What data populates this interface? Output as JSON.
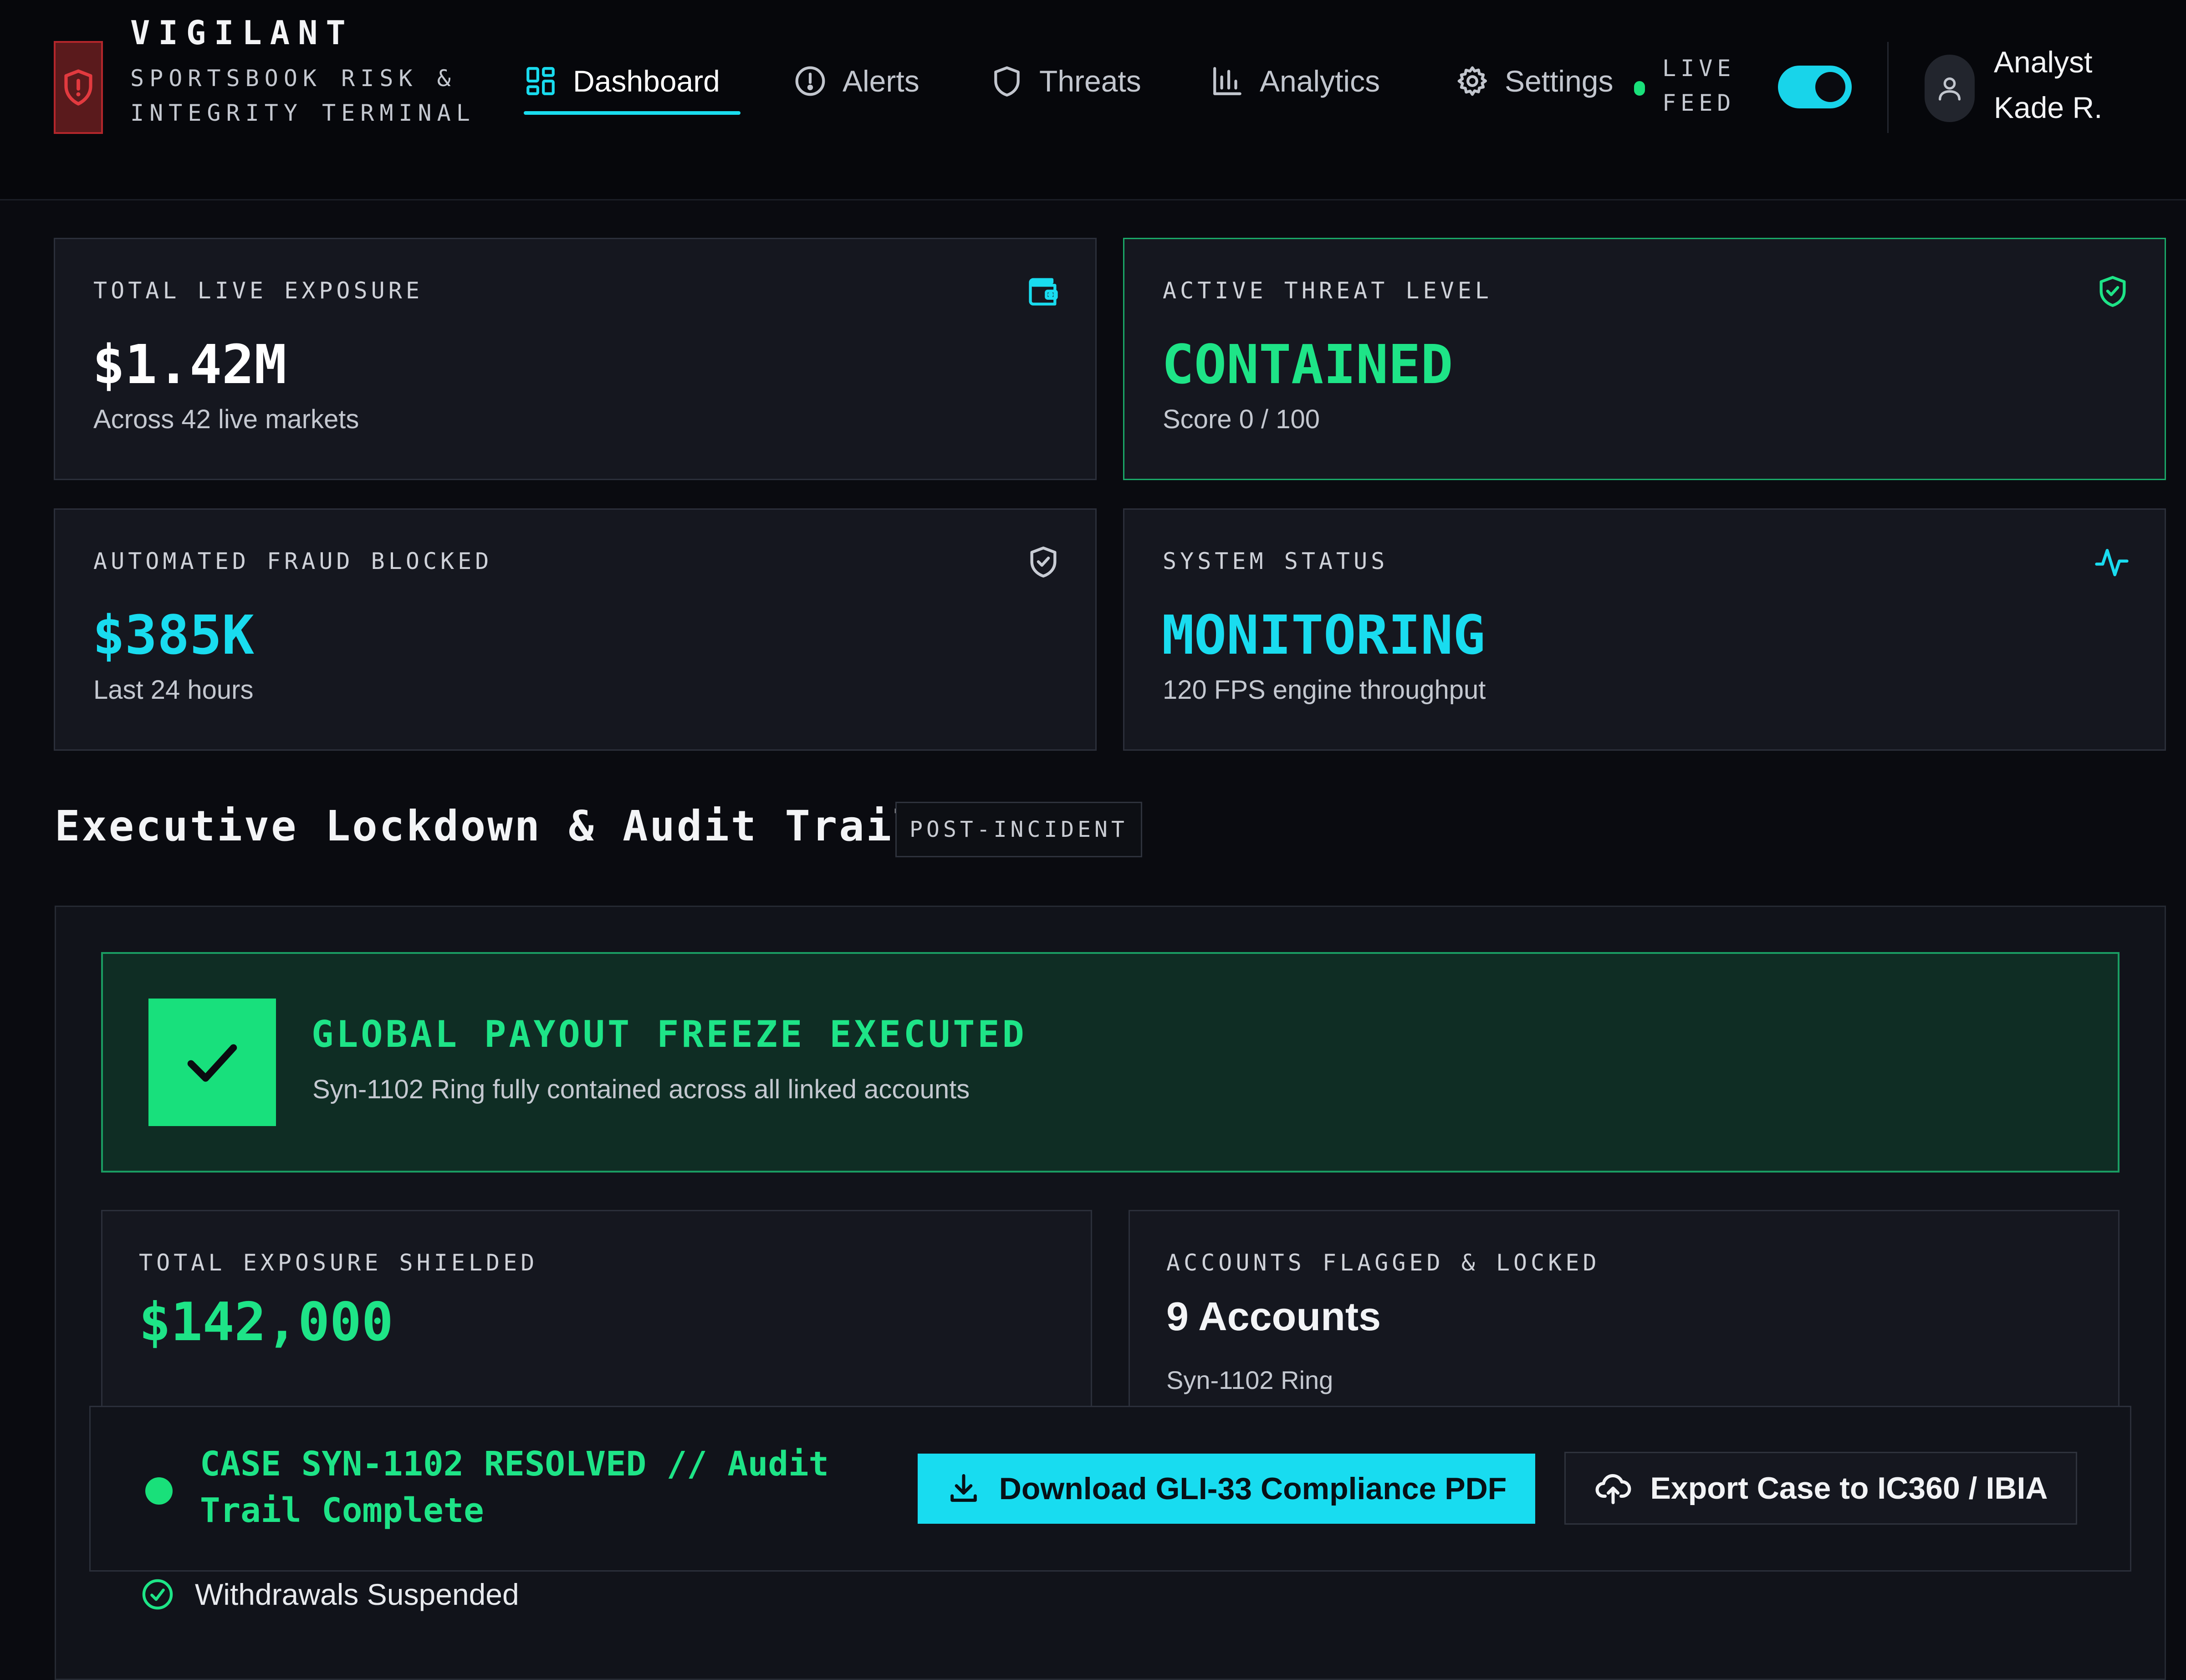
{
  "app": {
    "name": "VIGILANT",
    "subtitle": "SPORTSBOOK RISK & INTEGRITY TERMINAL"
  },
  "nav": {
    "items": [
      {
        "label": "Dashboard",
        "icon": "dashboard-grid-icon",
        "active": true
      },
      {
        "label": "Alerts",
        "icon": "alert-circle-icon",
        "active": false
      },
      {
        "label": "Threats",
        "icon": "shield-icon",
        "active": false
      },
      {
        "label": "Analytics",
        "icon": "bar-chart-icon",
        "active": false
      },
      {
        "label": "Settings",
        "icon": "gear-icon",
        "active": false
      }
    ]
  },
  "live_feed": {
    "label_line1": "LIVE",
    "label_line2": "FEED",
    "enabled": true
  },
  "user": {
    "line1": "Analyst",
    "line2": "Kade R."
  },
  "kpis": [
    {
      "label": "TOTAL LIVE EXPOSURE",
      "value": "$1.42M",
      "sub": "Across 42 live markets",
      "icon": "wallet-icon",
      "value_color": "#ffffff"
    },
    {
      "label": "ACTIVE THREAT LEVEL",
      "value": "CONTAINED",
      "sub": "Score 0 / 100",
      "icon": "shield-check-icon",
      "value_color": "#1ee487"
    },
    {
      "label": "AUTOMATED FRAUD BLOCKED",
      "value": "$385K",
      "sub": "Last 24 hours",
      "icon": "shield-check-icon",
      "value_color": "#19dcef"
    },
    {
      "label": "SYSTEM STATUS",
      "value": "MONITORING",
      "sub": "120 FPS engine throughput",
      "icon": "activity-pulse-icon",
      "value_color": "#19dcef"
    }
  ],
  "section": {
    "title": "Executive Lockdown & Audit Trail",
    "badge": "POST-INCIDENT"
  },
  "freeze": {
    "title": "GLOBAL PAYOUT FREEZE EXECUTED",
    "subtitle": "Syn-1102 Ring fully contained across all linked accounts"
  },
  "stats": {
    "exposure_label": "TOTAL EXPOSURE SHIELDED",
    "exposure_value": "$142,000",
    "accounts_label": "ACCOUNTS FLAGGED & LOCKED",
    "accounts_value": "9 Accounts",
    "accounts_sub": "Syn-1102 Ring"
  },
  "action_bar": {
    "status": "CASE SYN-1102 RESOLVED // Audit Trail Complete",
    "download_label": "Download GLI-33 Compliance PDF",
    "export_label": "Export Case to IC360 / IBIA"
  },
  "checklist": [
    {
      "label": "Withdrawals Suspended"
    }
  ],
  "colors": {
    "accent_cyan": "#19dcef",
    "accent_green": "#1ee487",
    "danger_red": "#b3262b",
    "background": "#0a0b10"
  }
}
